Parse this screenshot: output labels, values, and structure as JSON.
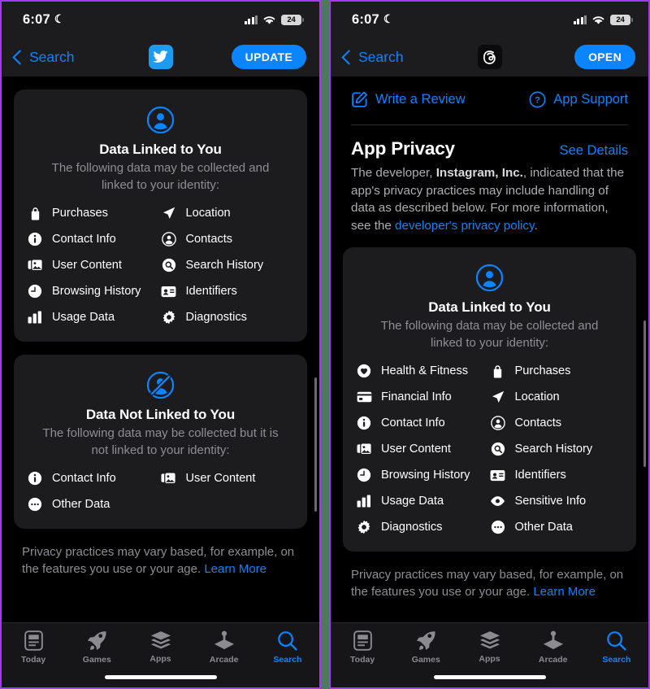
{
  "panels": [
    {
      "id": "twitter",
      "status": {
        "time": "6:07",
        "moon_icon": "crescent-moon-icon",
        "battery": "24"
      },
      "nav": {
        "back_label": "Search",
        "app_icon": "twitter-bird-icon",
        "action_label": "UPDATE"
      },
      "cards": [
        {
          "icon": "person-circle-icon",
          "title": "Data Linked to You",
          "subtitle": "The following data may be collected and linked to your identity:",
          "items": [
            {
              "icon": "bag-icon",
              "label": "Purchases"
            },
            {
              "icon": "location-arrow-icon",
              "label": "Location"
            },
            {
              "icon": "info-circle-icon",
              "label": "Contact Info"
            },
            {
              "icon": "person-circle-icon",
              "label": "Contacts"
            },
            {
              "icon": "photo-stack-icon",
              "label": "User Content"
            },
            {
              "icon": "search-circle-icon",
              "label": "Search History"
            },
            {
              "icon": "clock-icon",
              "label": "Browsing History"
            },
            {
              "icon": "id-card-icon",
              "label": "Identifiers"
            },
            {
              "icon": "bar-chart-icon",
              "label": "Usage Data"
            },
            {
              "icon": "gear-icon",
              "label": "Diagnostics"
            }
          ]
        },
        {
          "icon": "person-circle-slash-icon",
          "title": "Data Not Linked to You",
          "subtitle": "The following data may be collected but it is not linked to your identity:",
          "items": [
            {
              "icon": "info-circle-icon",
              "label": "Contact Info"
            },
            {
              "icon": "photo-stack-icon",
              "label": "User Content"
            },
            {
              "icon": "ellipsis-circle-icon",
              "label": "Other Data"
            }
          ]
        }
      ],
      "note": {
        "text": "Privacy practices may vary based, for example, on the features you use or your age. ",
        "link": "Learn More"
      }
    },
    {
      "id": "threads",
      "status": {
        "time": "6:07",
        "moon_icon": "crescent-moon-icon",
        "battery": "24"
      },
      "nav": {
        "back_label": "Search",
        "app_icon": "threads-icon",
        "action_label": "OPEN"
      },
      "actions": [
        {
          "icon": "compose-icon",
          "label": "Write a Review"
        },
        {
          "icon": "question-circle-icon",
          "label": "App Support"
        }
      ],
      "privacy": {
        "title": "App Privacy",
        "see_details": "See Details",
        "desc_part1": "The developer, ",
        "developer": "Instagram, Inc.",
        "desc_part2": ", indicated that the app's privacy practices may include handling of data as described below. For more information, see the ",
        "policy_link": "developer's privacy policy",
        "desc_part3": "."
      },
      "cards": [
        {
          "icon": "person-circle-icon",
          "title": "Data Linked to You",
          "subtitle": "The following data may be collected and linked to your identity:",
          "items": [
            {
              "icon": "heart-circle-icon",
              "label": "Health & Fitness"
            },
            {
              "icon": "bag-icon",
              "label": "Purchases"
            },
            {
              "icon": "credit-card-icon",
              "label": "Financial Info"
            },
            {
              "icon": "location-arrow-icon",
              "label": "Location"
            },
            {
              "icon": "info-circle-icon",
              "label": "Contact Info"
            },
            {
              "icon": "person-circle-icon",
              "label": "Contacts"
            },
            {
              "icon": "photo-stack-icon",
              "label": "User Content"
            },
            {
              "icon": "search-circle-icon",
              "label": "Search History"
            },
            {
              "icon": "clock-icon",
              "label": "Browsing History"
            },
            {
              "icon": "id-card-icon",
              "label": "Identifiers"
            },
            {
              "icon": "bar-chart-icon",
              "label": "Usage Data"
            },
            {
              "icon": "eye-icon",
              "label": "Sensitive Info"
            },
            {
              "icon": "gear-icon",
              "label": "Diagnostics"
            },
            {
              "icon": "ellipsis-circle-icon",
              "label": "Other Data"
            }
          ]
        }
      ],
      "note": {
        "text": "Privacy practices may vary based, for example, on the features you use or your age. ",
        "link": "Learn More"
      }
    }
  ],
  "tabbar": [
    {
      "icon": "today-icon",
      "label": "Today",
      "active": false
    },
    {
      "icon": "rocket-icon",
      "label": "Games",
      "active": false
    },
    {
      "icon": "layers-icon",
      "label": "Apps",
      "active": false
    },
    {
      "icon": "arcade-icon",
      "label": "Arcade",
      "active": false
    },
    {
      "icon": "search-icon",
      "label": "Search",
      "active": true
    }
  ],
  "colors": {
    "accent_blue": "#0a84ff",
    "card_bg": "#1c1c1e",
    "divider_green": "#4b7a5c",
    "frame_purple": "#a935f5",
    "secondary_text": "#8e8e93"
  }
}
